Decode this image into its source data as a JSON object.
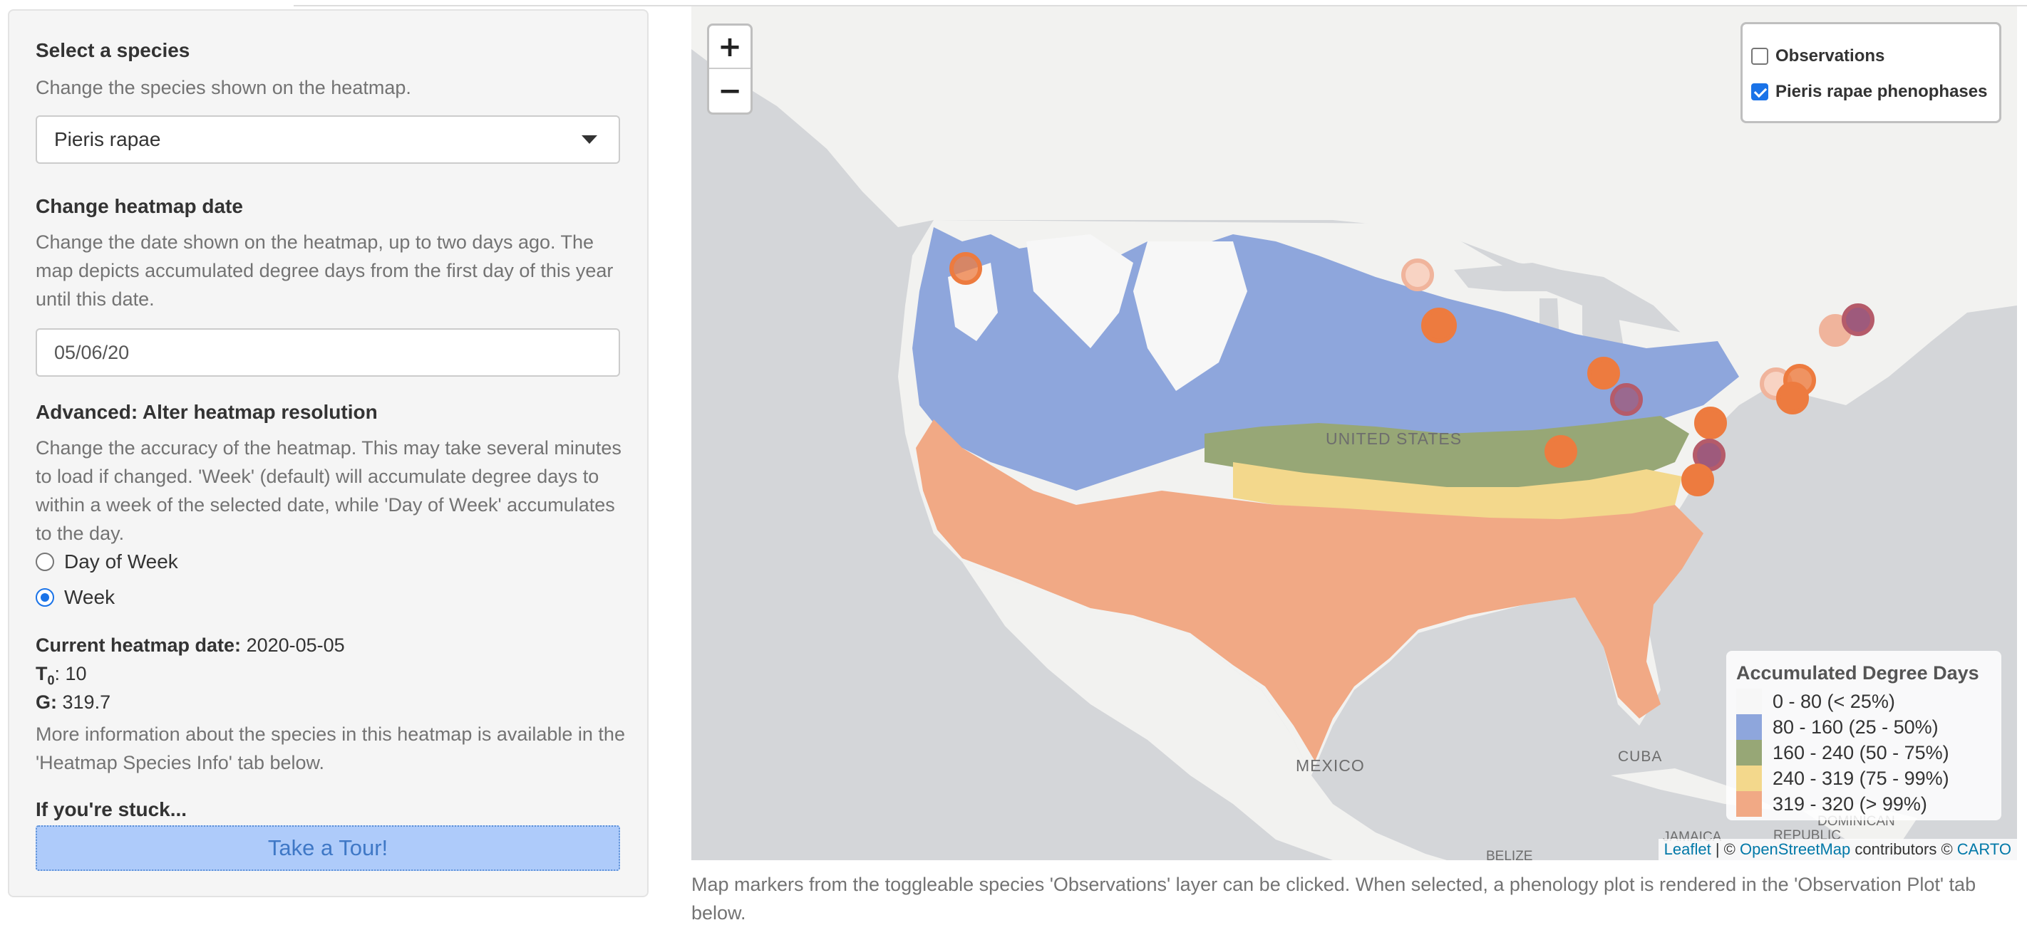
{
  "sidebar": {
    "species": {
      "label": "Select a species",
      "help": "Change the species shown on the heatmap.",
      "selected": "Pieris rapae"
    },
    "date": {
      "label": "Change heatmap date",
      "help": "Change the date shown on the heatmap, up to two days ago. The map depicts accumulated degree days from the first day of this year until this date.",
      "value": "05/06/20"
    },
    "resolution": {
      "label": "Advanced: Alter heatmap resolution",
      "help": "Change the accuracy of the heatmap. This may take several minutes to load if changed. 'Week' (default) will accumulate degree days to within a week of the selected date, while 'Day of Week' accumulates to the day.",
      "options": [
        {
          "label": "Day of Week",
          "selected": false
        },
        {
          "label": "Week",
          "selected": true
        }
      ]
    },
    "info": {
      "current_date_label": "Current heatmap date:",
      "current_date_value": "2020-05-05",
      "t0_label": "T",
      "t0_sub": "0",
      "t0_value": ": 10",
      "g_label": "G:",
      "g_value": "319.7",
      "more_info": "More information about the species in this heatmap is available in the 'Heatmap Species Info' tab below."
    },
    "stuck": {
      "label": "If you're stuck...",
      "button": "Take a Tour!"
    }
  },
  "map": {
    "zoom_in": "+",
    "zoom_out": "−",
    "layers": [
      {
        "label": "Observations",
        "checked": false
      },
      {
        "label": "Pieris rapae phenophases",
        "checked": true
      }
    ],
    "place_labels": {
      "us": "UNITED STATES",
      "mexico": "MEXICO",
      "cuba": "CUBA",
      "jamaica": "JAMAICA",
      "dominican": "DOMINICAN",
      "republic": "REPUBLIC",
      "belize": "BELIZE"
    },
    "legend": {
      "title": "Accumulated Degree Days",
      "items": [
        {
          "label": "0 - 80 (< 25%)",
          "color": "#f7f7f7"
        },
        {
          "label": "80 - 160 (25 - 50%)",
          "color": "#8ea6dc"
        },
        {
          "label": "160 - 240 (50 - 75%)",
          "color": "#97a776"
        },
        {
          "label": "240 - 319 (75 - 99%)",
          "color": "#f3d88c"
        },
        {
          "label": "319 - 320 (> 99%)",
          "color": "#f1a985"
        }
      ]
    },
    "attribution": {
      "leaflet": "Leaflet",
      "sep1": " | © ",
      "osm": "OpenStreetMap",
      "sep2": " contributors © ",
      "carto": "CARTO"
    },
    "colors": {
      "ocean": "#d4d6d9",
      "land": "#f2f2f0",
      "marker_orange": "#ed7b3f",
      "marker_pink": "#f0b49c",
      "marker_purple": "#9e5a7c"
    }
  },
  "caption": "Map markers from the toggleable species 'Observations' layer can be clicked. When selected, a phenology plot is rendered in the 'Observation Plot' tab below."
}
